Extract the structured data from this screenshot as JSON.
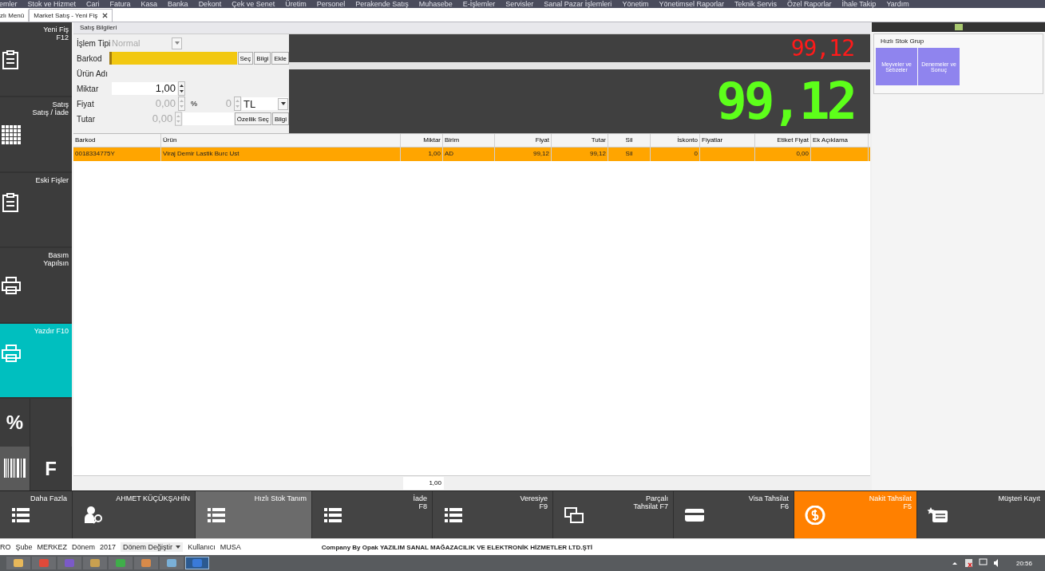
{
  "menu_bar": [
    "emler",
    "Stok ve Hizmet",
    "Cari",
    "Fatura",
    "Kasa",
    "Banka",
    "Dekont",
    "Çek ve Senet",
    "Üretim",
    "Personel",
    "Perakende Satış",
    "Muhasebe",
    "E-İşlemler",
    "Servisler",
    "Sanal Pazar İşlemleri",
    "Yönetim",
    "Yönetimsel Raporlar",
    "Teknik Servis",
    "Özel Raporlar",
    "İhale Takip",
    "Yardım"
  ],
  "tabs": [
    {
      "label": "zlı Menü",
      "selected": false,
      "closable": false
    },
    {
      "label": "Market Satış - Yeni Fiş",
      "selected": true,
      "closable": true
    }
  ],
  "sidebar": {
    "items": [
      {
        "lines": [
          "Yeni Fiş",
          "F12"
        ],
        "selected": false
      },
      {
        "lines": [
          "Satış",
          "Satış / İade"
        ],
        "selected": false
      },
      {
        "lines": [
          "Eski Fişler"
        ],
        "selected": false
      },
      {
        "lines": [
          "Basım",
          "Yapılsın"
        ],
        "selected": false
      },
      {
        "lines": [
          "Yazdır F10"
        ],
        "selected": true
      }
    ],
    "tiles": [
      {
        "label": "%"
      },
      {
        "label": "F"
      }
    ]
  },
  "form": {
    "title": "Satış Bilgileri",
    "islem_tipi": {
      "label": "İşlem Tipi",
      "value": "Normal",
      "disabled": true
    },
    "barkod": {
      "label": "Barkod",
      "buttons": [
        "Seç",
        "Bilgi",
        "Ekle"
      ]
    },
    "urun_adi": {
      "label": "Ürün Adı"
    },
    "miktar": {
      "label": "Miktar",
      "value": "1,00",
      "disabled": false
    },
    "fiyat": {
      "label": "Fiyat",
      "value": "0,00",
      "disabled": true,
      "percent_sign": "%",
      "percent": "0",
      "currency": "TL"
    },
    "tutar": {
      "label": "Tutar",
      "value": "0,00",
      "disabled": true,
      "buttons": [
        "Özellik Seç",
        "Bilgi"
      ]
    }
  },
  "displays": {
    "small": "99,12",
    "large": "99,12"
  },
  "table": {
    "columns": [
      "Barkod",
      "Ürün",
      "Miktar",
      "Birim",
      "Fiyat",
      "Tutar",
      "Sil",
      "İskonto",
      "Fiyatlar",
      "Etiket Fiyat",
      "Ek Açıklama"
    ],
    "rows": [
      {
        "selected": true,
        "cells": [
          "0018334775Y",
          "Viraj Demir Lastik Burc Ust",
          "1,00",
          "AD",
          "99,12",
          "99,12",
          "Sil",
          "0",
          null,
          "0,00",
          null
        ]
      }
    ],
    "footer_total": "1,00"
  },
  "quick_group": {
    "title": "Hızlı Stok Grup",
    "buttons": [
      {
        "lines": [
          "Meyveler ve",
          "Sebzeler"
        ]
      },
      {
        "lines": [
          "Denemeler ve",
          "Sonuç"
        ]
      }
    ]
  },
  "action_bar": [
    {
      "lines": [
        "Daha Fazla"
      ],
      "kind": "normal"
    },
    {
      "lines": [
        "AHMET KÜÇÜKŞAHİN"
      ],
      "kind": "normal"
    },
    {
      "lines": [
        "Hızlı Stok Tanım"
      ],
      "kind": "pressed"
    },
    {
      "lines": [
        "İade",
        "F8"
      ],
      "kind": "normal"
    },
    {
      "lines": [
        "Veresiye",
        "F9"
      ],
      "kind": "normal"
    },
    {
      "lines": [
        "Parçalı",
        "Tahsilat F7"
      ],
      "kind": "normal"
    },
    {
      "lines": [
        "Visa Tahsilat",
        "F6"
      ],
      "kind": "normal"
    },
    {
      "lines": [
        "Nakit Tahsilat",
        "F5"
      ],
      "kind": "accent"
    },
    {
      "lines": [
        "Müşteri Kayıt"
      ],
      "kind": "normal"
    }
  ],
  "status_bar": {
    "prefix": "RO",
    "items": [
      {
        "label": "Şube",
        "value": "MERKEZ"
      },
      {
        "label": "Dönem",
        "value": "2017"
      }
    ],
    "period_button": "Dönem Değiştir",
    "user_label": "Kullanıcı",
    "user": "MUSA",
    "company": "Company By Opak YAZILIM SANAL MAĞAZACILIK VE ELEKTRONİK HİZMETLER LTD.ŞTİ"
  },
  "taskbar": {
    "apps": [
      {
        "selected": false
      },
      {
        "selected": false
      },
      {
        "selected": false
      },
      {
        "selected": false
      },
      {
        "selected": false
      },
      {
        "selected": false
      },
      {
        "selected": false
      },
      {
        "selected": true
      }
    ],
    "clock": "20:56"
  }
}
